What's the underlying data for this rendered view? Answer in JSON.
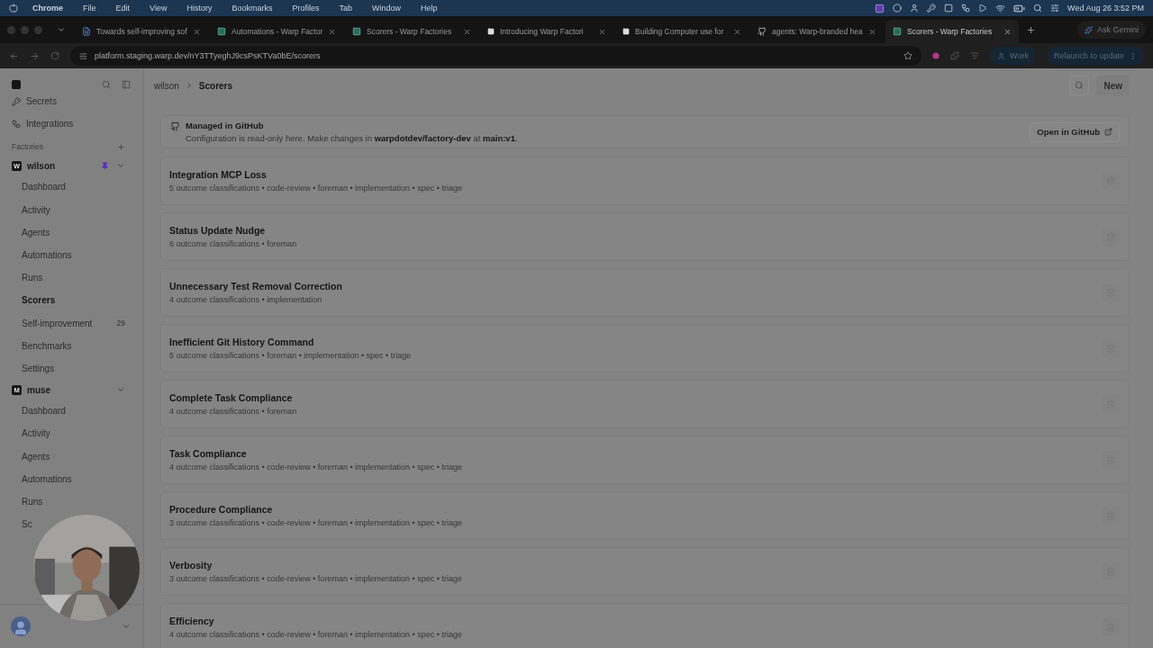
{
  "menubar": {
    "app": "Chrome",
    "menus": [
      "File",
      "Edit",
      "View",
      "History",
      "Bookmarks",
      "Profiles",
      "Tab",
      "Window",
      "Help"
    ],
    "clock": "Wed Aug 26  3:52 PM"
  },
  "tabs": [
    {
      "title": "Towards self-improving sof",
      "selected": false,
      "kind": "doc"
    },
    {
      "title": "Automations - Warp Factor",
      "selected": false,
      "kind": "warp"
    },
    {
      "title": "Scorers - Warp Factories",
      "selected": false,
      "kind": "warp"
    },
    {
      "title": "Introducing Warp Factori",
      "selected": false,
      "kind": "dark"
    },
    {
      "title": "Building Computer use for",
      "selected": false,
      "kind": "dark"
    },
    {
      "title": "agents: Warp-branded hea",
      "selected": false,
      "kind": "github"
    },
    {
      "title": "Scorers - Warp Factories",
      "selected": true,
      "kind": "warp"
    }
  ],
  "ask_button": "Ask Gemini",
  "address": "platform.staging.warp.dev/nY3TTyeghJ9csPsKTVa0bE/scorers",
  "profile": "Work",
  "relaunch": "Relaunch to update",
  "sidebar": {
    "top_items": [
      {
        "label": "Secrets",
        "selected": false
      },
      {
        "label": "Integrations",
        "selected": false
      }
    ],
    "section": "Factories",
    "factories": [
      {
        "badge": "W",
        "name": "wilson",
        "pinned": true,
        "expanded": true,
        "items": [
          {
            "label": "Dashboard",
            "selected": false
          },
          {
            "label": "Activity",
            "selected": false
          },
          {
            "label": "Agents",
            "selected": false
          },
          {
            "label": "Automations",
            "selected": false
          },
          {
            "label": "Runs",
            "selected": false
          },
          {
            "label": "Scorers",
            "selected": true
          },
          {
            "label": "Self-improvement",
            "selected": false,
            "count": "29"
          },
          {
            "label": "Benchmarks",
            "selected": false
          },
          {
            "label": "Settings",
            "selected": false
          }
        ]
      },
      {
        "badge": "M",
        "name": "muse",
        "pinned": false,
        "expanded": true,
        "items": [
          {
            "label": "Dashboard",
            "selected": false
          },
          {
            "label": "Activity",
            "selected": false
          },
          {
            "label": "Agents",
            "selected": false
          },
          {
            "label": "Automations",
            "selected": false
          },
          {
            "label": "Runs",
            "selected": false
          },
          {
            "label": "Sc",
            "selected": false
          }
        ]
      }
    ]
  },
  "breadcrumb": [
    "wilson",
    "Scorers"
  ],
  "new_button": "New",
  "banner": {
    "title": "Managed in GitHub",
    "text": "Configuration is read-only here. Make changes in **warpdotdev/factory-dev** at **main:v1**.",
    "button": "Open in GitHub"
  },
  "scorers": [
    {
      "name": "Integration MCP Loss",
      "meta": "5 outcome classifications • code-review • foreman • implementation • spec • triage"
    },
    {
      "name": "Status Update Nudge",
      "meta": "6 outcome classifications • foreman"
    },
    {
      "name": "Unnecessary Test Removal Correction",
      "meta": "4 outcome classifications • implementation"
    },
    {
      "name": "Inefficient Git History Command",
      "meta": "5 outcome classifications • foreman • implementation • spec • triage"
    },
    {
      "name": "Complete Task Compliance",
      "meta": "4 outcome classifications • foreman"
    },
    {
      "name": "Task Compliance",
      "meta": "4 outcome classifications • code-review • foreman • implementation • spec • triage"
    },
    {
      "name": "Procedure Compliance",
      "meta": "3 outcome classifications • code-review • foreman • implementation • spec • triage"
    },
    {
      "name": "Verbosity",
      "meta": "3 outcome classifications • code-review • foreman • implementation • spec • triage"
    },
    {
      "name": "Efficiency",
      "meta": "4 outcome classifications • code-review • foreman • implementation • spec • triage"
    }
  ]
}
